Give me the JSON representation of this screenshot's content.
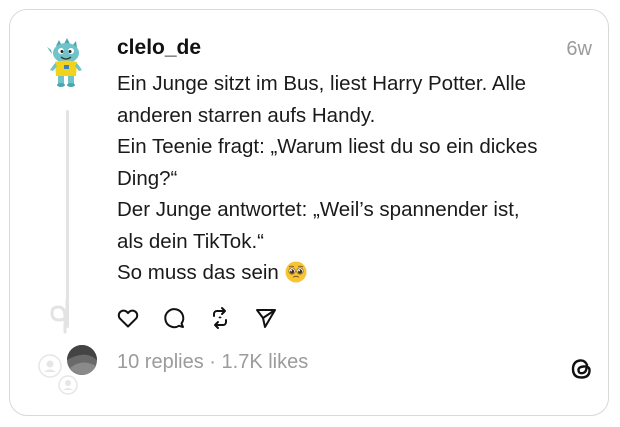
{
  "post": {
    "username": "clelo_de",
    "time": "6w",
    "lines": [
      "Ein Junge sitzt im Bus, liest Harry Potter. Alle",
      "anderen starren aufs Handy.",
      "Ein Teenie fragt: „Warum liest du so ein dickes",
      "Ding?“",
      "Der Junge antwortet: „Weil’s spannender ist,",
      "als dein TikTok.“",
      "So muss das sein"
    ],
    "emoji": "pleading-face-emoji"
  },
  "stats": {
    "replies": "10 replies",
    "separator": "·",
    "likes": "1.7K likes"
  },
  "icons": {
    "like": "heart-icon",
    "reply": "comment-icon",
    "repost": "repost-icon",
    "share": "send-icon",
    "brand": "threads-logo-icon"
  },
  "colors": {
    "text": "#1a1a1a",
    "muted": "#9b9b9b",
    "border": "#d9d9d9",
    "avatar_green": "#6fc3c9",
    "avatar_yellow": "#f2d21b"
  }
}
